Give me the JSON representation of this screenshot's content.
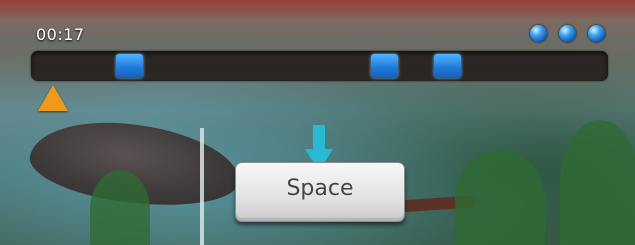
{
  "hud": {
    "time": "00:17",
    "lives": [
      "life",
      "life",
      "life"
    ],
    "notes": [
      "note",
      "note",
      "note"
    ]
  },
  "prompt": {
    "key_label": "Space",
    "arrow_icon": "down-arrow-icon",
    "colors": {
      "arrow": "#27b9d6",
      "marker": "#f09a1a",
      "note": "#1f78d8",
      "life": "#2a8ee6"
    }
  }
}
